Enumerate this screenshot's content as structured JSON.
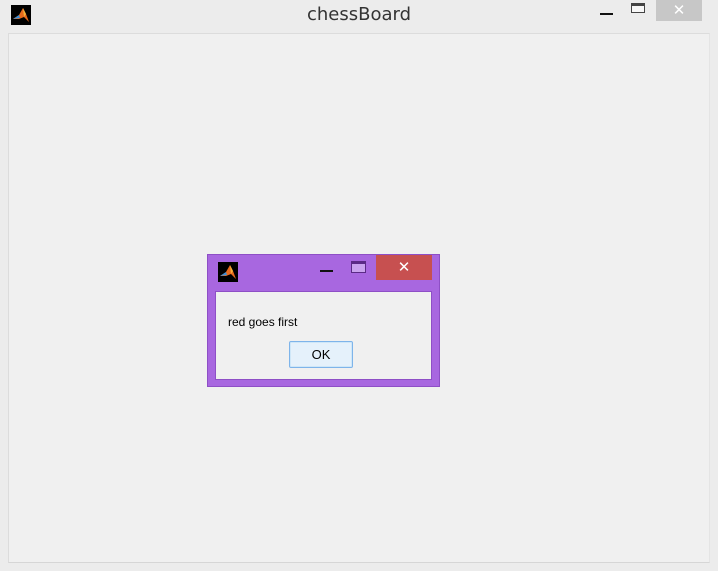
{
  "main_window": {
    "title": "chessBoard",
    "icon": "matlab-icon",
    "controls": {
      "minimize": "minimize-icon",
      "maximize": "maximize-icon",
      "close": "✕"
    }
  },
  "dialog": {
    "icon": "matlab-icon",
    "title": "",
    "message": "red goes first",
    "ok_label": "OK",
    "controls": {
      "minimize": "minimize-icon",
      "maximize": "maximize-icon",
      "close": "✕"
    },
    "accent_color": "#a867e0",
    "close_color": "#c75050"
  }
}
